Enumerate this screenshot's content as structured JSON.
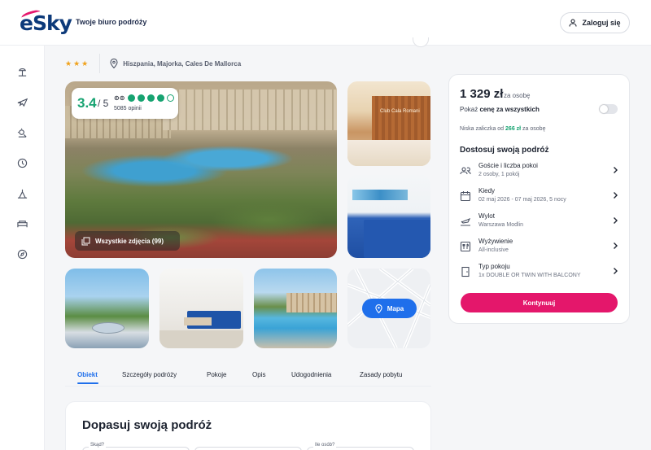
{
  "header": {
    "logo_text": "eSky",
    "tagline": "Twoje biuro podróży",
    "login_label": "Zaloguj się"
  },
  "sidebar": {
    "icons": [
      "beach-icon",
      "plane-icon",
      "sun-icon",
      "clock-icon",
      "tent-icon",
      "bed-icon",
      "compass-icon"
    ]
  },
  "hotel": {
    "stars": "★★★",
    "location": "Hiszpania, Majorka, Cales De Mallorca",
    "rating_score": "3.4",
    "rating_max": "/ 5",
    "reviews": "5085 opinii",
    "tripadvisor_rating": 4,
    "all_photos_label": "Wszystkie zdjęcia (99)",
    "map_label": "Mapa",
    "reception_sign": "Club Cala Romani"
  },
  "tabs": [
    "Obiekt",
    "Szczegóły podróży",
    "Pokoje",
    "Opis",
    "Udogodnienia",
    "Zasady pobytu"
  ],
  "active_tab": "Obiekt",
  "bottom": {
    "title": "Dopasuj swoją podróż",
    "from_label": "Skąd?",
    "guests_label": "Ile osób?"
  },
  "panel": {
    "price": "1 329 zł",
    "per_person": "za osobę",
    "show_total_prefix": "Pokaż ",
    "show_total_bold": "cenę za wszystkich",
    "deposit_prefix": "Niska zaliczka od ",
    "deposit_amount": "266 zł",
    "deposit_suffix": " za osobę",
    "customize_title": "Dostosuj swoją podróż",
    "options": [
      {
        "title": "Goście i liczba pokoi",
        "sub": "2 osoby, 1 pokój"
      },
      {
        "title": "Kiedy",
        "sub": "02 maj 2026 - 07 maj 2026, 5 nocy"
      },
      {
        "title": "Wylot",
        "sub": "Warszawa Modlin"
      },
      {
        "title": "Wyżywienie",
        "sub": "All-inclusive"
      },
      {
        "title": "Typ pokoju",
        "sub": "1x DOUBLE OR TWIN WITH BALCONY"
      }
    ],
    "continue_label": "Kontynuuj"
  },
  "colors": {
    "brand_blue": "#1f6feb",
    "brand_pink": "#e4176b",
    "rating_green": "#17a371",
    "star_orange": "#f0a21c"
  }
}
